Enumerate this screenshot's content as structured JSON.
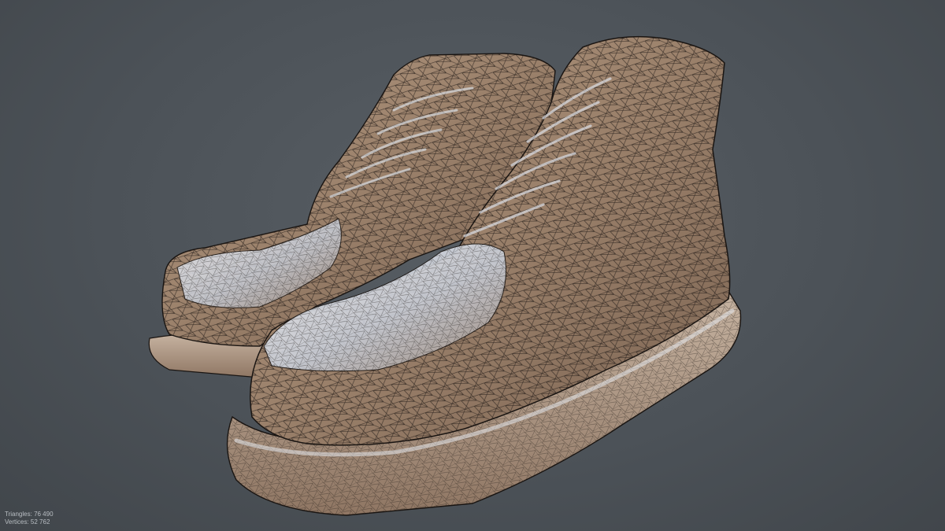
{
  "viewport": {
    "background": "#4c5258",
    "mesh_color": "#9c8470",
    "wire_color": "#1a1512",
    "highlight_color": "#e8ecf2"
  },
  "model": {
    "object": "boots-pair-wireframe"
  },
  "stats": {
    "triangles_label": "Triangles:",
    "triangles_value": "76 490",
    "vertices_label": "Vertices:",
    "vertices_value": "52 762"
  }
}
